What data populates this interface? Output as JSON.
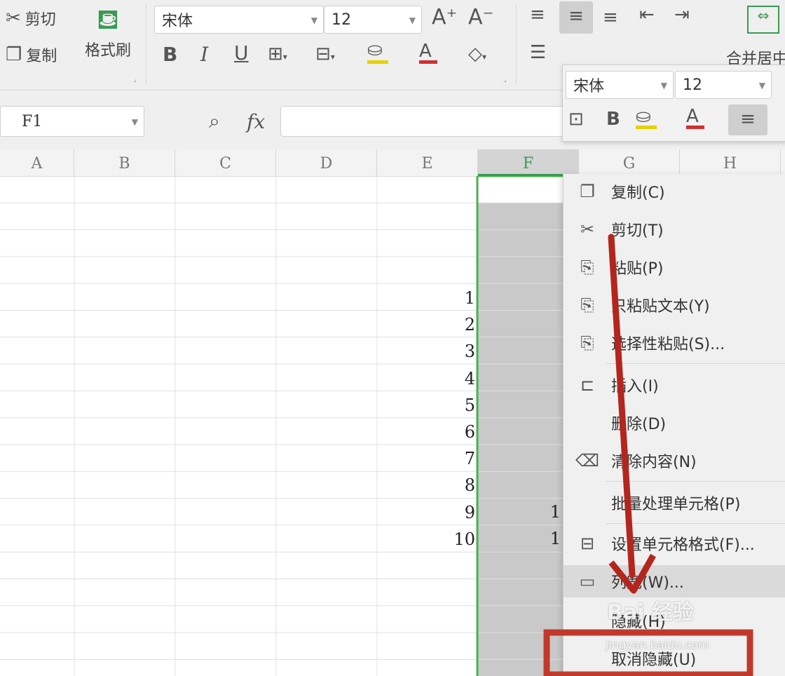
{
  "ribbon": {
    "cut_label": "剪切",
    "copy_label": "复制",
    "format_painter_label": "格式刷",
    "font_name": "宋体",
    "font_size": "12",
    "grow_font": "A⁺",
    "shrink_font": "A⁻",
    "bold": "B",
    "italic": "I",
    "underline": "U",
    "merge_center_label": "合并居中"
  },
  "formula_bar": {
    "name_box": "F1",
    "fx_label": "fx",
    "formula_value": ""
  },
  "grid": {
    "columns": [
      "A",
      "B",
      "C",
      "D",
      "E",
      "F",
      "G",
      "H"
    ],
    "selected_column": "F",
    "e_values": [
      "1",
      "2",
      "3",
      "4",
      "5",
      "6",
      "7",
      "8",
      "9",
      "10"
    ],
    "f_partial": [
      "1",
      "1"
    ]
  },
  "mini_toolbar": {
    "font_name": "宋体",
    "font_size": "12",
    "bold": "B",
    "font_color_glyph": "A"
  },
  "context_menu": {
    "items": [
      {
        "label": "复制(C)",
        "icon": "copy-icon"
      },
      {
        "label": "剪切(T)",
        "icon": "scissors-icon"
      },
      {
        "label": "粘贴(P)",
        "icon": "paste-icon"
      },
      {
        "label": "只粘贴文本(Y)",
        "icon": "paste-text-icon"
      },
      {
        "label": "选择性粘贴(S)...",
        "icon": "paste-special-icon"
      },
      {
        "label": "插入(I)",
        "icon": "insert-icon"
      },
      {
        "label": "删除(D)",
        "icon": ""
      },
      {
        "label": "清除内容(N)",
        "icon": "eraser-icon"
      },
      {
        "label": "批量处理单元格(P)",
        "icon": ""
      },
      {
        "label": "设置单元格格式(F)...",
        "icon": "format-cells-icon"
      },
      {
        "label": "列宽(W)...",
        "icon": "column-width-icon"
      },
      {
        "label": "隐藏(H)",
        "icon": ""
      },
      {
        "label": "取消隐藏(U)",
        "icon": ""
      }
    ]
  },
  "watermark": {
    "brand": "Bai 经验",
    "url": "jingyan.baidu.com"
  },
  "colors": {
    "selection_green": "#4caf50",
    "annotation_red": "#c0392b",
    "selected_col_fill": "#c9c9c9"
  }
}
